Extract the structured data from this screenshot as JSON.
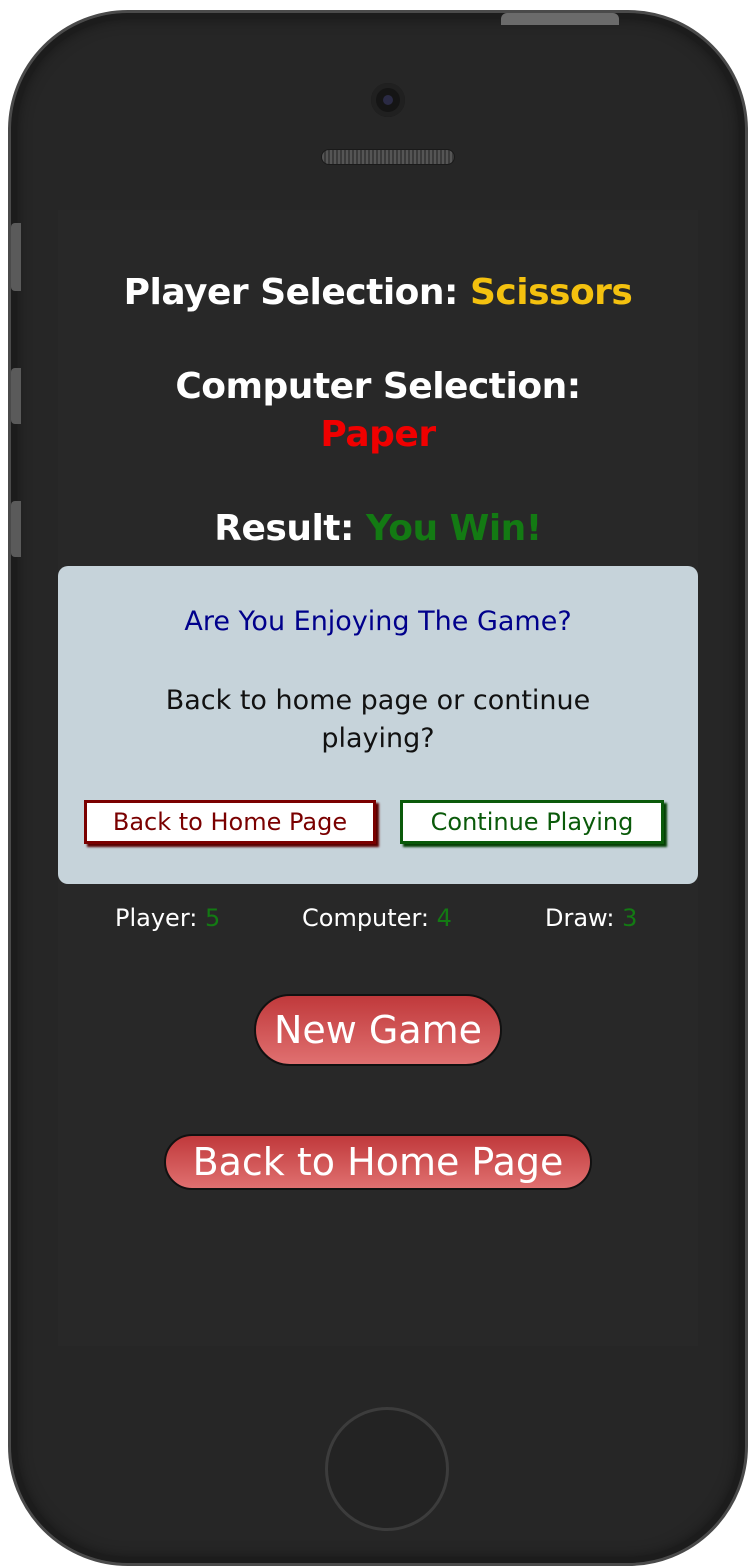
{
  "game": {
    "player_selection_label": "Player Selection:",
    "player_selection_value": "Scissors",
    "computer_selection_label": "Computer Selection:",
    "computer_selection_value": "Paper",
    "result_label": "Result:",
    "result_value": "You Win!"
  },
  "modal": {
    "title": "Are You Enjoying The Game?",
    "text": "Back to home page or continue playing?",
    "home_button": "Back to Home Page",
    "continue_button": "Continue Playing"
  },
  "scores": {
    "player_label": "Player:",
    "player_value": "5",
    "computer_label": "Computer:",
    "computer_value": "4",
    "draw_label": "Draw:",
    "draw_value": "3"
  },
  "actions": {
    "new_game": "New Game",
    "back_home": "Back to Home Page"
  },
  "colors": {
    "player_choice": "#f4c10f",
    "computer_choice": "#f00000",
    "win": "#137a13",
    "modal_bg": "#c6d3da",
    "button_gradient_top": "#c0393b"
  }
}
